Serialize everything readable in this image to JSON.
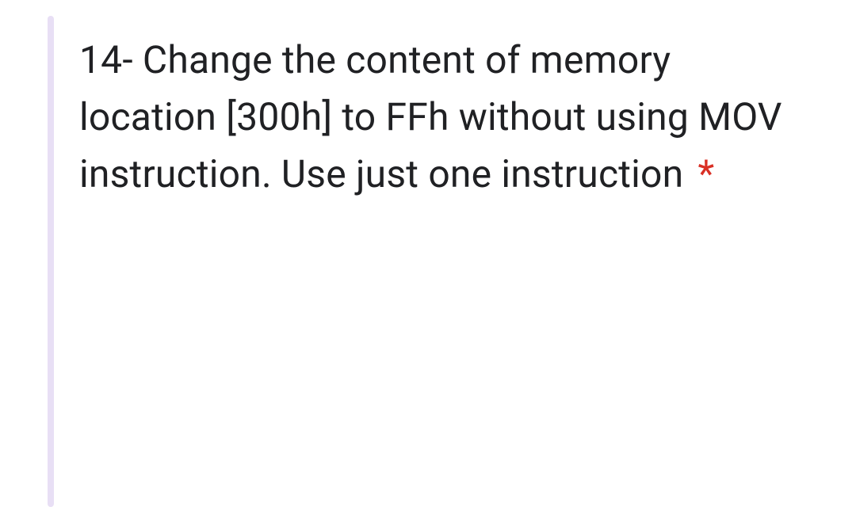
{
  "question": {
    "number": "14",
    "text": "14- Change the content of memory location [300h] to FFh without using MOV instruction. Use just one instruction",
    "required_marker": "*"
  }
}
